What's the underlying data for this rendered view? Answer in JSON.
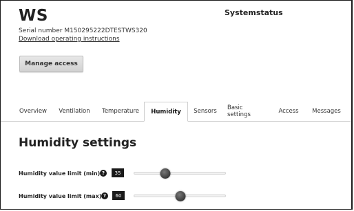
{
  "device": {
    "title": "WS",
    "serial": "Serial number M150295222DTESTWS320",
    "download_link": "Download operating instructions"
  },
  "header": {
    "status_title": "Systemstatus"
  },
  "buttons": {
    "manage_access": "Manage access"
  },
  "tabs": [
    {
      "label": "Overview",
      "active": false
    },
    {
      "label": "Ventilation",
      "active": false
    },
    {
      "label": "Temperature",
      "active": false
    },
    {
      "label": "Humidity",
      "active": true
    },
    {
      "label": "Sensors",
      "active": false
    },
    {
      "label": "Basic settings",
      "active": false
    },
    {
      "label": "Access",
      "active": false
    },
    {
      "label": "Messages",
      "active": false
    }
  ],
  "section": {
    "title": "Humidity settings"
  },
  "settings": [
    {
      "label": "Humidity value limit (min)",
      "help_icon": "question-circle-icon",
      "help_glyph": "?",
      "value": "35",
      "slider_fraction": 0.34
    },
    {
      "label": "Humidity value limit (max)",
      "help_icon": "question-circle-icon",
      "help_glyph": "?",
      "value": "60",
      "slider_fraction": 0.51
    }
  ],
  "colors": {
    "dark": "#1a1a1a",
    "border": "#cfcfcf",
    "button_bg": "#d8d8d8"
  }
}
